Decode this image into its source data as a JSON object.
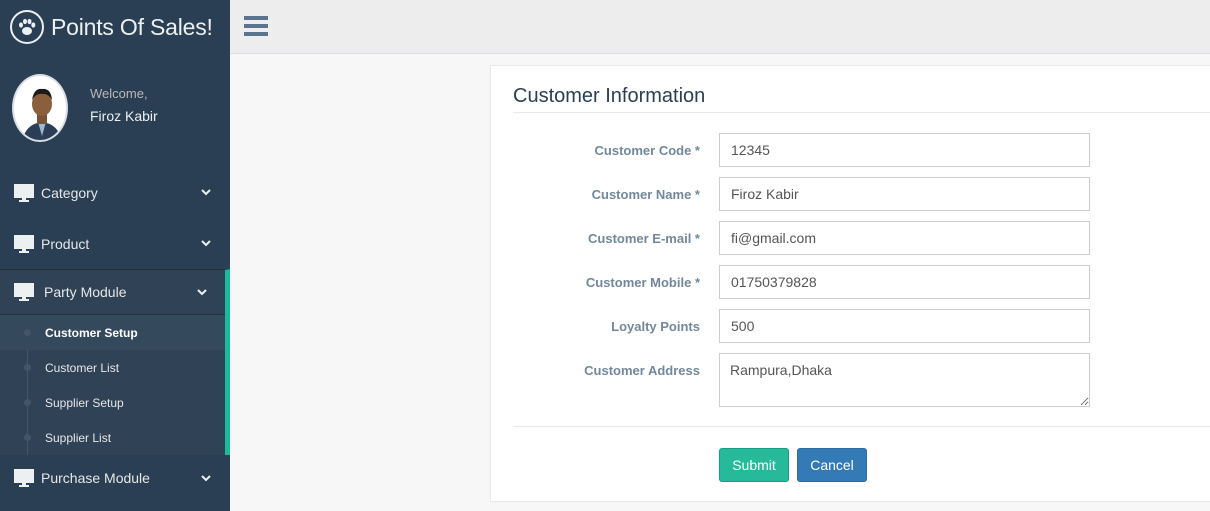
{
  "brand": {
    "title": "Points Of Sales!",
    "icon": "paw-icon"
  },
  "profile": {
    "welcome": "Welcome,",
    "name": "Firoz Kabir"
  },
  "menu": {
    "category": "Category",
    "product": "Product",
    "party_module": "Party Module",
    "submenu": [
      "Customer Setup",
      "Customer List",
      "Supplier Setup",
      "Supplier List"
    ],
    "purchase_module": "Purchase Module"
  },
  "panel": {
    "title": "Customer Information"
  },
  "form": {
    "customer_code": {
      "label": "Customer Code *",
      "value": "12345"
    },
    "customer_name": {
      "label": "Customer Name *",
      "value": "Firoz Kabir"
    },
    "customer_email": {
      "label": "Customer E-mail *",
      "value": "fi@gmail.com"
    },
    "customer_mobile": {
      "label": "Customer Mobile *",
      "value": "01750379828"
    },
    "loyalty_points": {
      "label": "Loyalty Points",
      "value": "500"
    },
    "customer_address": {
      "label": "Customer Address",
      "value": "Rampura,Dhaka"
    }
  },
  "buttons": {
    "submit": "Submit",
    "cancel": "Cancel"
  },
  "colors": {
    "sidebar": "#2a3f54",
    "accent": "#1ABB9C",
    "submit": "#26B99A",
    "cancel": "#337ab7"
  }
}
